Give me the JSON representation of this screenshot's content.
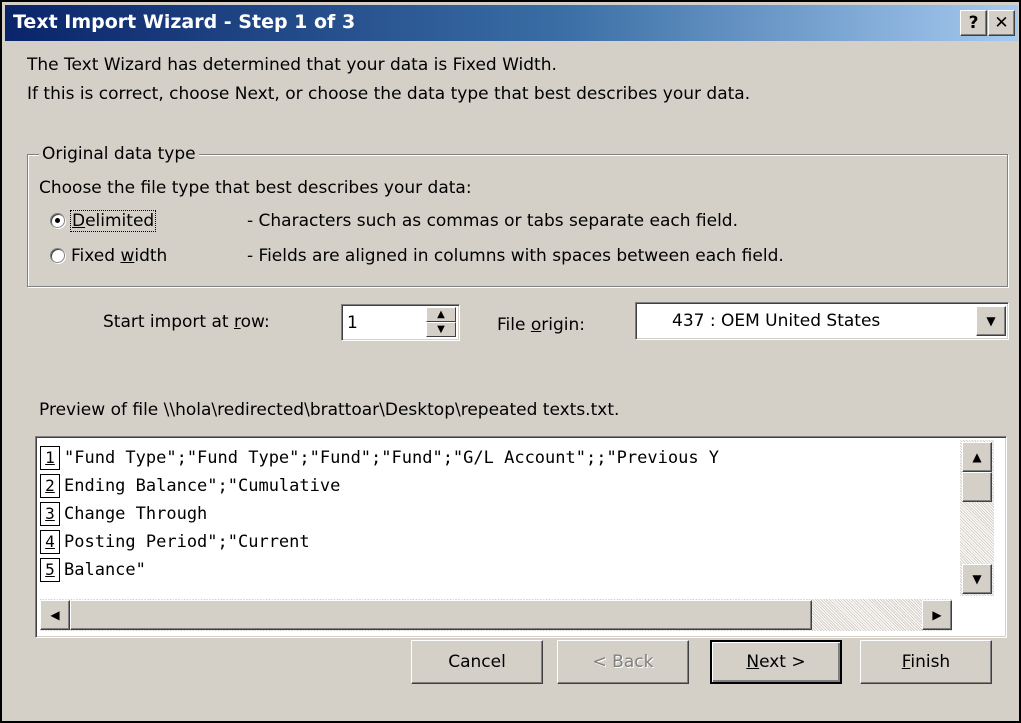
{
  "window": {
    "title": "Text Import Wizard - Step 1 of 3",
    "help_label": "?",
    "close_label": "✕"
  },
  "intro": {
    "line1": "The Text Wizard has determined that your data is Fixed Width.",
    "line2": "If this is correct, choose Next, or choose the data type that best describes your data."
  },
  "data_type": {
    "legend": "Original data type",
    "prompt": "Choose the file type that best describes your data:",
    "options": [
      {
        "label_pre": "",
        "label_acc": "D",
        "label_post": "elimited",
        "description": "- Characters such as commas or tabs separate each field.",
        "selected": true
      },
      {
        "label_pre": "Fixed ",
        "label_acc": "w",
        "label_post": "idth",
        "description": "- Fields are aligned in columns with spaces between each field.",
        "selected": false
      }
    ]
  },
  "start_row": {
    "label_pre": "Start import at ",
    "label_acc": "r",
    "label_post": "ow:",
    "value": "1"
  },
  "file_origin": {
    "label_pre": "File ",
    "label_acc": "o",
    "label_post": "rigin:",
    "value": "437 : OEM United States"
  },
  "preview": {
    "caption": "Preview of file \\\\hola\\redirected\\brattoar\\Desktop\\repeated texts.txt.",
    "rows": [
      {
        "num": "1",
        "text": "\"Fund Type\";\"Fund Type\";\"Fund\";\"Fund\";\"G/L Account\";;\"Previous Y"
      },
      {
        "num": "2",
        "text": "Ending Balance\";\"Cumulative"
      },
      {
        "num": "3",
        "text": "Change Through"
      },
      {
        "num": "4",
        "text": "Posting Period\";\"Current"
      },
      {
        "num": "5",
        "text": "Balance\""
      }
    ]
  },
  "buttons": {
    "cancel": "Cancel",
    "back": "< Back",
    "next_acc": "N",
    "next_post": "ext >",
    "finish_acc": "F",
    "finish_post": "inish"
  },
  "icons": {
    "spin_up": "▲",
    "spin_down": "▼",
    "dropdown": "▼",
    "scroll_up": "▲",
    "scroll_down": "▼",
    "scroll_left": "◀",
    "scroll_right": "▶"
  }
}
